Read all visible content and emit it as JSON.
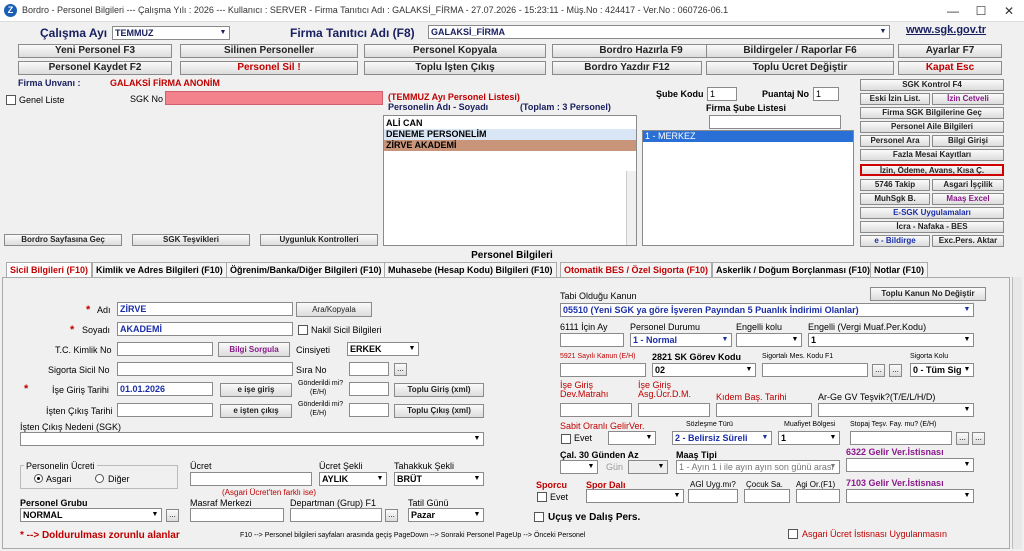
{
  "window": {
    "title": "Bordro - Personel Bilgileri   ---  Çalışma Yılı : 2026   ---   Kullanıcı : SERVER - Firma Tanıtıcı Adı : GALAKSİ_FİRMA - 27.07.2026 - 15:23:11 - Müş.No : 424417 - Ver.No : 060726-06.1"
  },
  "header": {
    "period_label": "Çalışma Ayı",
    "period_value": "TEMMUZ",
    "firm_label": "Firma Tanıtıcı Adı (F8)",
    "firm_value": "GALAKSİ_FİRMA",
    "website": "www.sgk.gov.tr"
  },
  "toolbar": {
    "row1": [
      "Yeni Personel F3",
      "Silinen Personeller",
      "Personel Kopyala",
      "Bordro Hazırla F9",
      "Bildirgeler / Raporlar F6",
      "Ayarlar F7"
    ],
    "row2": [
      "Personel Kaydet F2",
      "Personel Sil !",
      "Toplu İşten Çıkış",
      "Bordro Yazdır F12",
      "Toplu Ücret Değiştir",
      "Kapat Esc"
    ]
  },
  "top": {
    "firm_name_label": "Firma Unvanı :",
    "firm_name_value": "GALAKSİ FİRMA ANONİM",
    "general_list_label": "Genel Liste",
    "sgk_no_label": "SGK No",
    "list_title": "(TEMMUZ Ayı Personel Listesi)",
    "list_col": "Personelin Adı - Soyadı",
    "list_total": "(Toplam : 3 Personel)",
    "personnel": [
      "ALİ CAN",
      "DENEME PERSONELİM",
      "ZİRVE  AKADEMİ"
    ],
    "branch_code_label": "Şube Kodu",
    "branch_code_value": "1",
    "score_label": "Puantaj No",
    "score_value": "1",
    "branch_list_title": "Firma Şube Listesi",
    "branches": [
      "1 - MERKEZ"
    ]
  },
  "side_buttons": {
    "sgk_control": "SGK Kontrol F4",
    "old_entry": "Eski İzin List.",
    "leave_chart": "İzin Cetveli",
    "firm_sgk": "Firma SGK Bilgilerine Geç",
    "family": "Personel Aile Bilgileri",
    "search": "Personel Ara",
    "info_entry": "Bilgi Girişi",
    "overtime": "Fazla Mesai Kayıtları",
    "leave_payment": "İzin, Ödeme, Avans, Kısa Ç.",
    "track_5746": "5746 Takip",
    "min_wage": "Asgari İşçilik",
    "muhsgk": "MuhSgk B.",
    "salary_excel": "Maaş Excel",
    "esgk": "E-SGK Uygulamaları",
    "icra": "İcra - Nafaka - BES",
    "ebildirge": "e - Bildirge",
    "exc_pers": "Exc.Pers. Aktar"
  },
  "bottom_left_buttons": [
    "Bordro Sayfasına Geç",
    "SGK Teşvikleri",
    "Uygunluk Kontrolleri"
  ],
  "section_title": "Personel Bilgileri",
  "tabs": [
    "Sicil Bilgileri (F10)",
    "Kimlik ve Adres Bilgileri (F10)",
    "Öğrenim/Banka/Diğer Bilgileri (F10)",
    "Muhasebe (Hesap Kodu) Bilgileri (F10)",
    "Otomatik BES / Özel Sigorta (F10)",
    "Askerlik / Doğum Borçlanması (F10)",
    "Notlar (F10)"
  ],
  "form": {
    "name_label": "Adı",
    "name_value": "ZİRVE",
    "surname_label": "Soyadı",
    "surname_value": "AKADEMİ",
    "search_copy": "Ara/Kopyala",
    "nakil_label": "Nakil Sicil Bilgileri",
    "tc_label": "T.C. Kimlik No",
    "query_btn": "Bilgi Sorgula",
    "gender_label": "Cinsiyeti",
    "gender_value": "ERKEK",
    "sicil_label": "Sigorta Sicil No",
    "sira_label": "Sıra No",
    "entry_label": "İşe Giriş Tarihi",
    "entry_value": "01.01.2026",
    "e_entry": "e işe giriş",
    "sent_label": "Gönderildi mi?",
    "sent_sub": "(E/H)",
    "bulk_entry": "Toplu Giriş (xml)",
    "exit_label": "İşten Çıkış Tarihi",
    "e_exit": "e işten çıkış",
    "bulk_exit": "Toplu Çıkış (xml)",
    "exit_reason_label": "İşten Çıkış Nedeni (SGK)",
    "wage_group_label": "Personelin Ücreti",
    "wage_min": "Asgari",
    "wage_other": "Diğer",
    "wage_label": "Ücret",
    "wage_type_label": "Ücret Şekli",
    "wage_type_value": "AYLIK",
    "accrual_label": "Tahakkuk Şekli",
    "accrual_value": "BRÜT",
    "wage_note": "(Asgari Ücret'ten farklı ise)",
    "group_label": "Personel Grubu",
    "group_value": "NORMAL",
    "cost_label": "Masraf Merkezi",
    "dept_label": "Departman (Grup) F1",
    "holiday_label": "Tatil Günü",
    "holiday_value": "Pazar",
    "flight_label": "Uçuş ve Dalış Pers.",
    "required_note": "* --> Doldurulması zorunlu alanlar",
    "footer_hint": "F10 --> Personel bilgileri sayfaları arasında geçiş  PageDown --> Sonraki Personel     PageUp --> Önceki Personel"
  },
  "right_form": {
    "law_label": "Tabi Olduğu Kanun",
    "law_btn": "Toplu Kanun No Değiştir",
    "law_value": "05510 (Yeni SGK ya göre İşveren Payından 5 Puanlık İndirimi Olanlar)",
    "k6111": "6111 İçin Ay",
    "status_label": "Personel Durumu",
    "status_value": "1 - Normal",
    "disabled_label": "Engelli kolu",
    "disabled_tax_label": "Engelli (Vergi Muaf.Per.Kodu)",
    "disabled_tax_value": "1",
    "k5921": "5921 Sayılı Kanun (E/H)",
    "duty_label": "2821 SK Görev Kodu",
    "duty_value": "02",
    "insurance_f1": "Sigortalı Mes. Kodu F1",
    "ins_branch_label": "Sigorta Kolu",
    "ins_branch_value": "0 - Tüm Sig",
    "dev_base": "İşe Giriş Dev.Matrahı",
    "min_wage_dm": "İşe Giriş Asg.Ücr.D.M.",
    "seniority": "Kıdem Baş. Tarihi",
    "rnd_label": "Ar-Ge GV Teşvik?(T/E/L/H/D)",
    "fixed_income": "Sabit Oranlı GelirVer.",
    "yes_label": "Evet",
    "contract_label": "Sözleşme Türü",
    "contract_value": "2 - Belirsiz Süreli",
    "exempt_region": "Muafiyet Bölgesi",
    "exempt_value": "1",
    "stopaj": "Stopaj Teşv. Fay. mu? (E/H)",
    "work30": "Çal. 30 Günden Az",
    "day_label": "Gün",
    "salary_type_label": "Maaş Tipi",
    "salary_type_value": "1 - Ayın 1 i ile ayın ayın son günü arası",
    "k6322": "6322 Gelir Ver.İstisnası",
    "athlete_label": "Sporcu",
    "sport_branch": "Spor Dalı",
    "agi_label": "AGİ Uyg.mı?",
    "child_label": "Çocuk Sa.",
    "agi_rate": "Agi Or.(F1)",
    "k7103": "7103 Gelir Ver.İstisnası",
    "min_wage_exempt": "Asgari Ücret İstisnası Uygulanmasın"
  }
}
